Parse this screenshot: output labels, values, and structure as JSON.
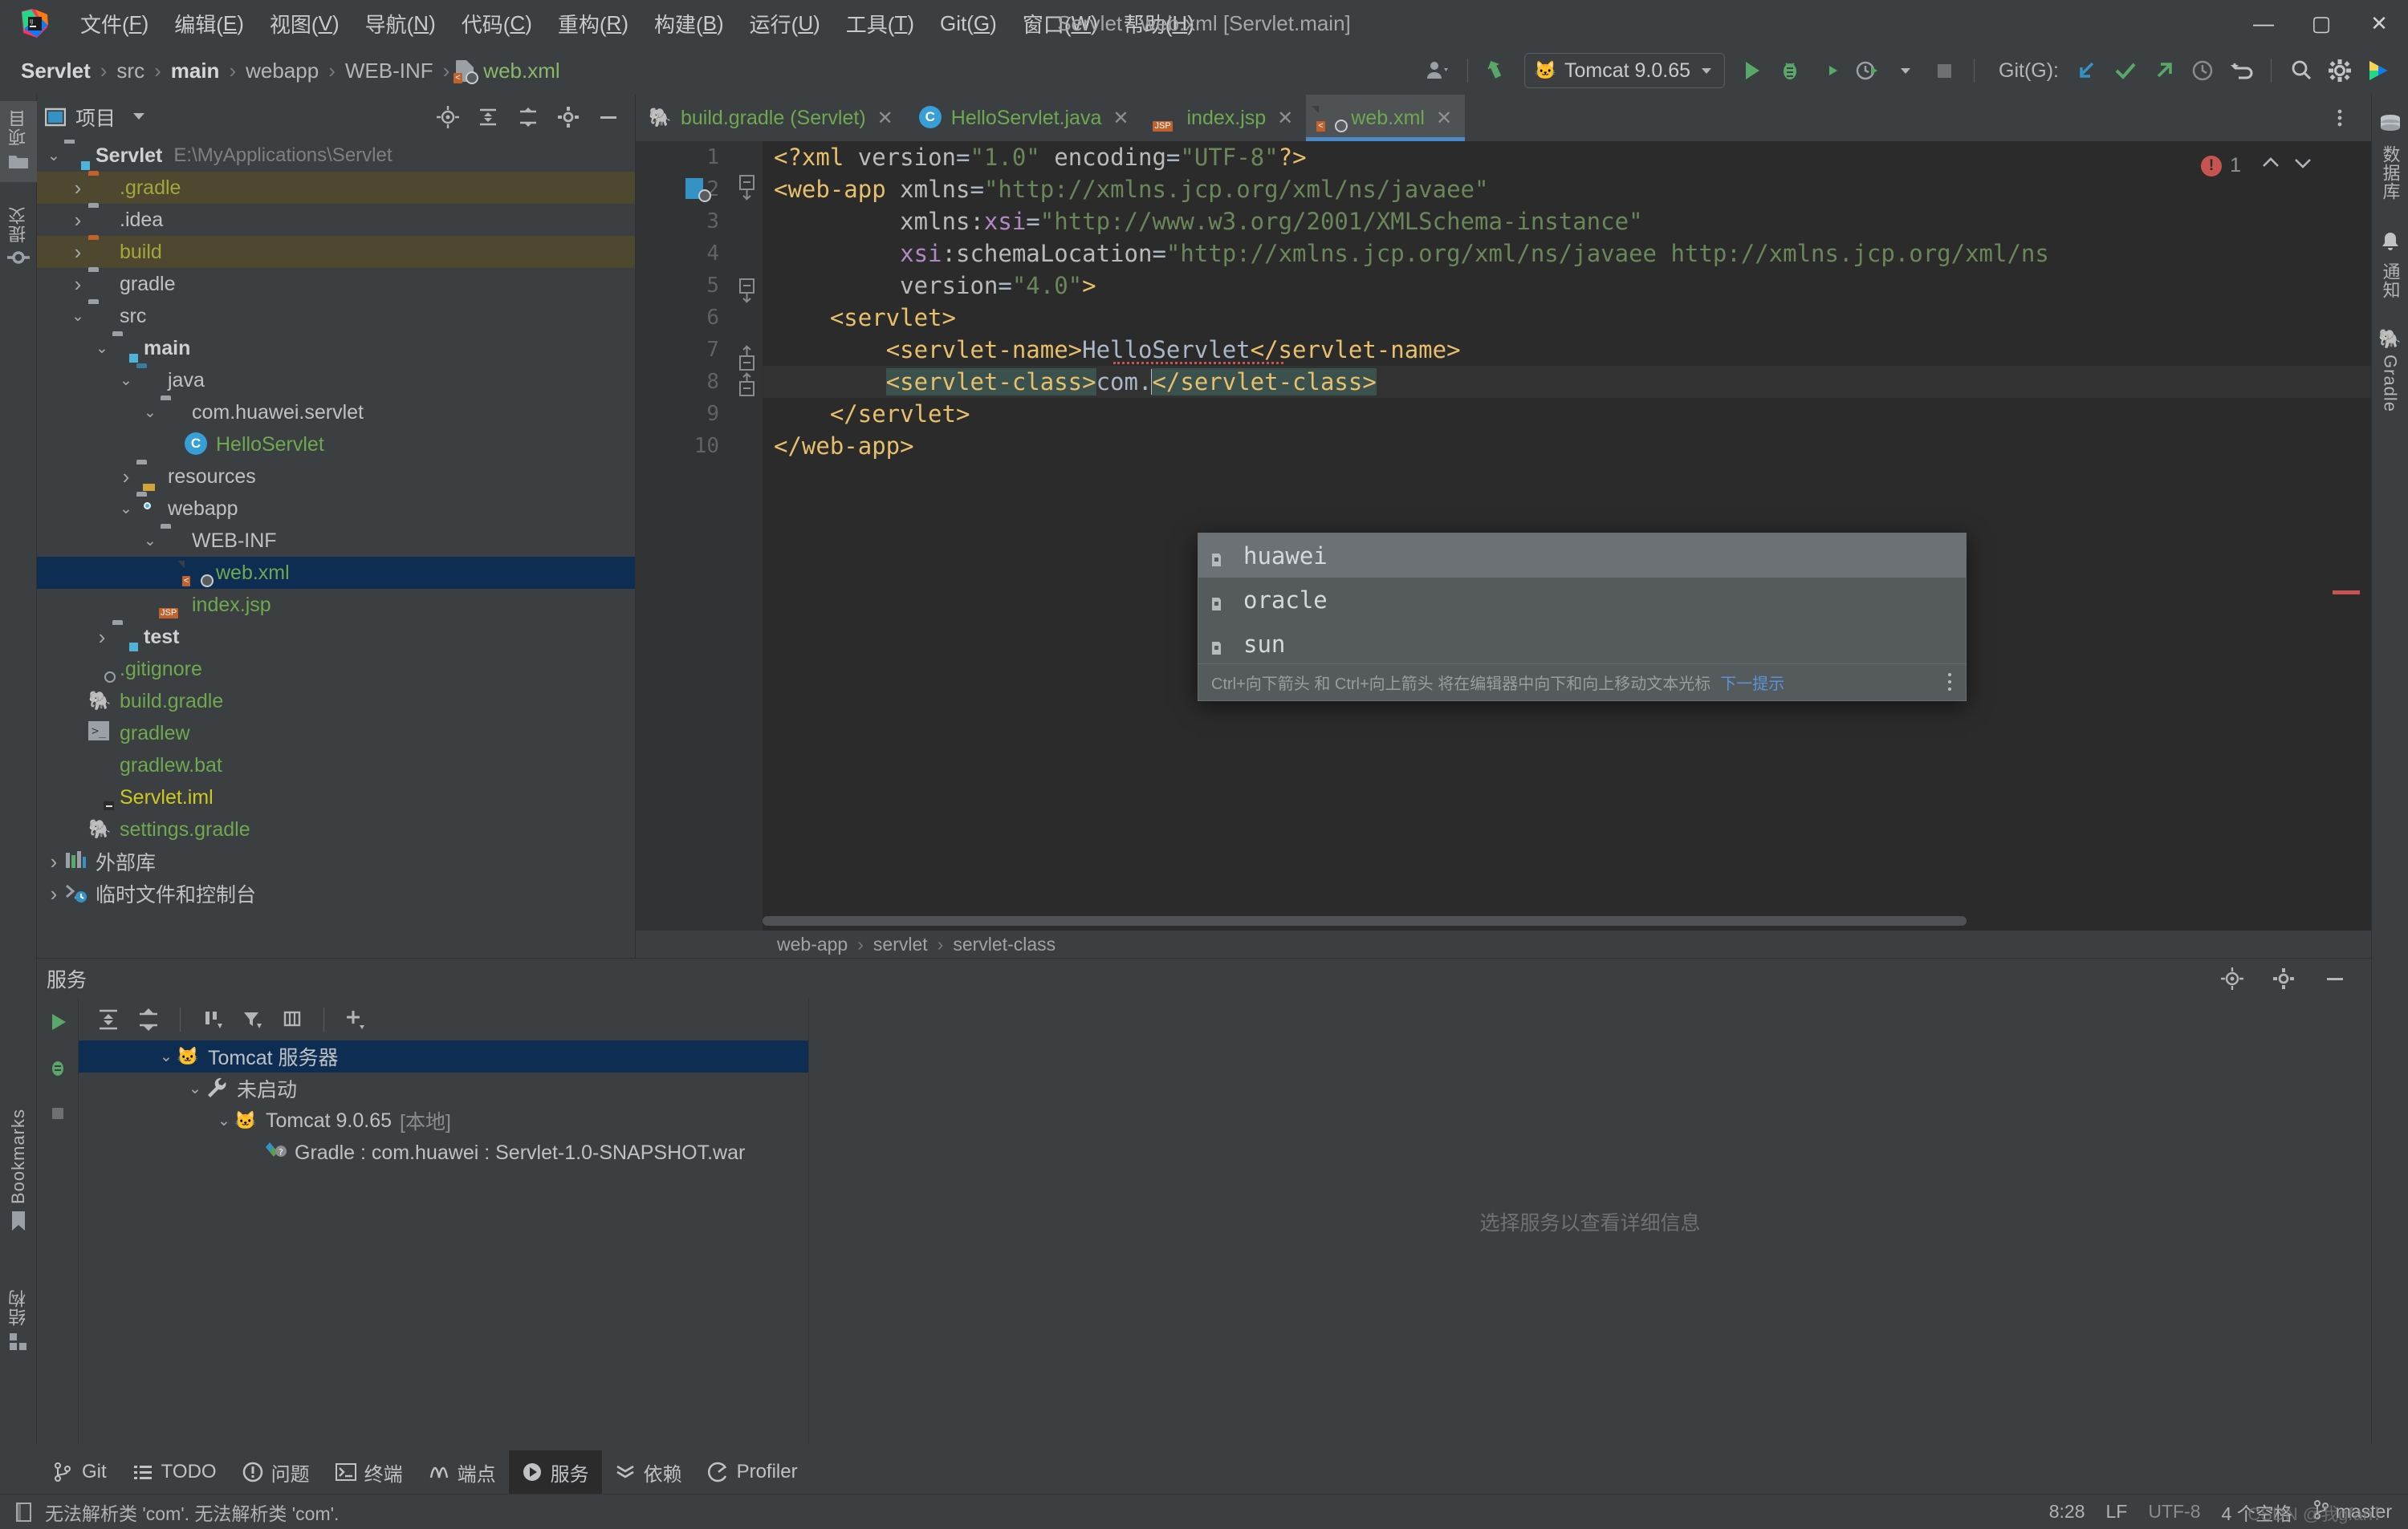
{
  "window": {
    "title": "Servlet - web.xml [Servlet.main]",
    "minimize": "—",
    "maximize": "▢",
    "close": "✕"
  },
  "menubar": {
    "items": [
      {
        "label": "文件(F)",
        "mnemonic": "F"
      },
      {
        "label": "编辑(E)",
        "mnemonic": "E"
      },
      {
        "label": "视图(V)",
        "mnemonic": "V"
      },
      {
        "label": "导航(N)",
        "mnemonic": "N"
      },
      {
        "label": "代码(C)",
        "mnemonic": "C"
      },
      {
        "label": "重构(R)",
        "mnemonic": "R"
      },
      {
        "label": "构建(B)",
        "mnemonic": "B"
      },
      {
        "label": "运行(U)",
        "mnemonic": "U"
      },
      {
        "label": "工具(T)",
        "mnemonic": "T"
      },
      {
        "label": "Git(G)",
        "mnemonic": "G"
      },
      {
        "label": "窗口(W)",
        "mnemonic": "W"
      },
      {
        "label": "帮助(H)",
        "mnemonic": "H"
      }
    ]
  },
  "navbar": {
    "breadcrumbs": [
      {
        "label": "Servlet",
        "style": "bold"
      },
      {
        "label": "src",
        "style": "normal"
      },
      {
        "label": "main",
        "style": "bold"
      },
      {
        "label": "webapp",
        "style": "normal"
      },
      {
        "label": "WEB-INF",
        "style": "normal"
      },
      {
        "label": "web.xml",
        "style": "green",
        "icon": "xml-file-icon"
      }
    ],
    "separator": "›",
    "run_config": "Tomcat 9.0.65",
    "git_label": "Git(G):",
    "icons": [
      "account-icon",
      "updates-icon",
      "run-icon",
      "debug-icon",
      "run-coverage-icon",
      "profiler-icon",
      "stop-icon",
      "git-update-icon",
      "git-commit-icon",
      "git-push-icon",
      "history-icon",
      "undo-icon",
      "search-icon",
      "settings-icon",
      "ide-feature-icon"
    ]
  },
  "left_rail": {
    "items": [
      {
        "label": "项目",
        "icon": "project-icon",
        "active": true
      },
      {
        "label": "提交",
        "icon": "commit-icon",
        "active": false
      }
    ],
    "bottom_items": [
      {
        "label": "Bookmarks",
        "icon": "bookmark-icon"
      },
      {
        "label": "结构",
        "icon": "structure-icon"
      }
    ]
  },
  "right_rail": {
    "items": [
      {
        "label": "数据库",
        "icon": "database-icon"
      },
      {
        "label": "通知",
        "icon": "bell-icon"
      },
      {
        "label": "Gradle",
        "icon": "gradle-elephant-icon"
      }
    ]
  },
  "project_panel": {
    "title": "项目",
    "header_icons": [
      "locate-icon",
      "expand-all-icon",
      "collapse-all-icon",
      "settings-icon",
      "hide-icon"
    ],
    "tree": [
      {
        "label": "Servlet",
        "path": "E:\\MyApplications\\Servlet",
        "depth": 0,
        "arrow": "down",
        "icon": "module-folder-icon",
        "style": "bold",
        "state": "normal"
      },
      {
        "label": ".gradle",
        "depth": 1,
        "arrow": "right",
        "icon": "folder-excluded-icon",
        "style": "olive",
        "state": "excluded"
      },
      {
        "label": ".idea",
        "depth": 1,
        "arrow": "right",
        "icon": "folder-icon",
        "style": "normal",
        "state": "normal"
      },
      {
        "label": "build",
        "depth": 1,
        "arrow": "right",
        "icon": "folder-excluded-icon",
        "style": "olive",
        "state": "excluded"
      },
      {
        "label": "gradle",
        "depth": 1,
        "arrow": "right",
        "icon": "folder-icon",
        "style": "normal",
        "state": "normal"
      },
      {
        "label": "src",
        "depth": 1,
        "arrow": "down",
        "icon": "folder-icon",
        "style": "normal",
        "state": "normal"
      },
      {
        "label": "main",
        "depth": 2,
        "arrow": "down",
        "icon": "module-folder-icon",
        "style": "bold",
        "state": "normal"
      },
      {
        "label": "java",
        "depth": 3,
        "arrow": "down",
        "icon": "source-folder-icon",
        "style": "normal",
        "state": "normal"
      },
      {
        "label": "com.huawei.servlet",
        "depth": 4,
        "arrow": "down",
        "icon": "package-icon",
        "style": "normal",
        "state": "normal"
      },
      {
        "label": "HelloServlet",
        "depth": 5,
        "arrow": "none",
        "icon": "java-class-icon",
        "style": "green",
        "state": "normal"
      },
      {
        "label": "resources",
        "depth": 3,
        "arrow": "right",
        "icon": "resources-folder-icon",
        "style": "normal",
        "state": "normal"
      },
      {
        "label": "webapp",
        "depth": 3,
        "arrow": "down",
        "icon": "web-folder-icon",
        "style": "normal",
        "state": "normal"
      },
      {
        "label": "WEB-INF",
        "depth": 4,
        "arrow": "down",
        "icon": "folder-icon",
        "style": "normal",
        "state": "normal"
      },
      {
        "label": "web.xml",
        "depth": 5,
        "arrow": "none",
        "icon": "xml-file-icon",
        "style": "green",
        "state": "selected"
      },
      {
        "label": "index.jsp",
        "depth": 4,
        "arrow": "none",
        "icon": "jsp-file-icon",
        "style": "green",
        "state": "normal"
      },
      {
        "label": "test",
        "depth": 2,
        "arrow": "right",
        "icon": "module-folder-icon",
        "style": "bold",
        "state": "normal"
      },
      {
        "label": ".gitignore",
        "depth": 1,
        "arrow": "none",
        "icon": "gitignore-file-icon",
        "style": "green",
        "state": "normal"
      },
      {
        "label": "build.gradle",
        "depth": 1,
        "arrow": "none",
        "icon": "gradle-file-icon",
        "style": "green",
        "state": "normal"
      },
      {
        "label": "gradlew",
        "depth": 1,
        "arrow": "none",
        "icon": "shell-file-icon",
        "style": "green",
        "state": "normal"
      },
      {
        "label": "gradlew.bat",
        "depth": 1,
        "arrow": "none",
        "icon": "bat-file-icon",
        "style": "green",
        "state": "normal"
      },
      {
        "label": "Servlet.iml",
        "depth": 1,
        "arrow": "none",
        "icon": "iml-file-icon",
        "style": "yellow",
        "state": "normal"
      },
      {
        "label": "settings.gradle",
        "depth": 1,
        "arrow": "none",
        "icon": "gradle-file-icon",
        "style": "green",
        "state": "normal"
      },
      {
        "label": "外部库",
        "depth": 0,
        "arrow": "right",
        "icon": "libraries-icon",
        "style": "normal",
        "state": "normal"
      },
      {
        "label": "临时文件和控制台",
        "depth": 0,
        "arrow": "right",
        "icon": "scratches-icon",
        "style": "normal",
        "state": "normal"
      }
    ]
  },
  "editor": {
    "tabs": [
      {
        "label": "build.gradle (Servlet)",
        "icon": "gradle-file-icon",
        "active": false,
        "close": "✕"
      },
      {
        "label": "HelloServlet.java",
        "icon": "java-class-icon",
        "active": false,
        "close": "✕"
      },
      {
        "label": "index.jsp",
        "icon": "jsp-file-icon",
        "active": false,
        "close": "✕"
      },
      {
        "label": "web.xml",
        "icon": "xml-file-icon",
        "active": true,
        "close": "✕"
      }
    ],
    "error_count": "1",
    "error_icon": "error-circle-icon",
    "nav_up": "⌃",
    "nav_down": "⌄",
    "line_numbers": [
      "1",
      "2",
      "3",
      "4",
      "5",
      "6",
      "7",
      "8",
      "9",
      "10"
    ],
    "lines": [
      {
        "n": 1,
        "segments": [
          {
            "t": "<?xml ",
            "c": "punct"
          },
          {
            "t": "version",
            "c": "attr"
          },
          {
            "t": "=",
            "c": "txtval"
          },
          {
            "t": "\"1.0\"",
            "c": "str"
          },
          {
            "t": " ",
            "c": "txtval"
          },
          {
            "t": "encoding",
            "c": "attr"
          },
          {
            "t": "=",
            "c": "txtval"
          },
          {
            "t": "\"UTF-8\"",
            "c": "str"
          },
          {
            "t": "?>",
            "c": "punct"
          }
        ]
      },
      {
        "n": 2,
        "segments": [
          {
            "t": "<web-app",
            "c": "tagname"
          },
          {
            "t": " ",
            "c": "txtval"
          },
          {
            "t": "xmlns",
            "c": "attr"
          },
          {
            "t": "=",
            "c": "txtval"
          },
          {
            "t": "\"http://xmlns.jcp.org/xml/ns/javaee\"",
            "c": "str"
          }
        ]
      },
      {
        "n": 3,
        "segments": [
          {
            "t": "         ",
            "c": "txtval"
          },
          {
            "t": "xmlns:",
            "c": "attr"
          },
          {
            "t": "xsi",
            "c": "attrns"
          },
          {
            "t": "=",
            "c": "txtval"
          },
          {
            "t": "\"http://www.w3.org/2001/XMLSchema-instance\"",
            "c": "str"
          }
        ]
      },
      {
        "n": 4,
        "segments": [
          {
            "t": "         ",
            "c": "txtval"
          },
          {
            "t": "xsi",
            "c": "attrns"
          },
          {
            "t": ":schemaLocation",
            "c": "attr"
          },
          {
            "t": "=",
            "c": "txtval"
          },
          {
            "t": "\"http://xmlns.jcp.org/xml/ns/javaee http://xmlns.jcp.org/xml/ns",
            "c": "str"
          }
        ]
      },
      {
        "n": 5,
        "segments": [
          {
            "t": "         ",
            "c": "txtval"
          },
          {
            "t": "version",
            "c": "attr"
          },
          {
            "t": "=",
            "c": "txtval"
          },
          {
            "t": "\"4.0\"",
            "c": "str"
          },
          {
            "t": ">",
            "c": "punct"
          }
        ]
      },
      {
        "n": 6,
        "segments": [
          {
            "t": "    ",
            "c": "txtval"
          },
          {
            "t": "<servlet>",
            "c": "tagname"
          }
        ]
      },
      {
        "n": 7,
        "segments": [
          {
            "t": "        ",
            "c": "txtval"
          },
          {
            "t": "<servlet-name>",
            "c": "tagname"
          },
          {
            "t": "HelloServlet",
            "c": "txtval"
          },
          {
            "t": "</servlet-name>",
            "c": "tagname"
          }
        ]
      },
      {
        "n": 8,
        "segments": [
          {
            "t": "        ",
            "c": "txtval"
          },
          {
            "t": "<servlet-class>",
            "c": "tagname hl-tag"
          },
          {
            "t": "com.",
            "c": "txtval"
          },
          {
            "t": "</servlet-class>",
            "c": "tagname hl-tag"
          }
        ]
      },
      {
        "n": 9,
        "segments": [
          {
            "t": "    ",
            "c": "txtval"
          },
          {
            "t": "</servlet>",
            "c": "tagname"
          }
        ]
      },
      {
        "n": 10,
        "segments": [
          {
            "t": "</web-app>",
            "c": "tagname"
          }
        ]
      }
    ],
    "bottom_breadcrumb": [
      "web-app",
      "servlet",
      "servlet-class"
    ],
    "bottom_breadcrumb_sep": "›"
  },
  "autocomplete": {
    "items": [
      {
        "label": "huawei",
        "icon": "package-icon",
        "selected": true
      },
      {
        "label": "oracle",
        "icon": "package-icon",
        "selected": false
      },
      {
        "label": "sun",
        "icon": "package-icon",
        "selected": false
      }
    ],
    "hint": "Ctrl+向下箭头 和 Ctrl+向上箭头 将在编辑器中向下和向上移动文本光标",
    "hint_link": "下一提示",
    "more_icon": "more-vertical-icon"
  },
  "services": {
    "title": "服务",
    "header_icons": [
      "locate-icon",
      "settings-icon",
      "hide-icon"
    ],
    "rail_icons": [
      "run-icon",
      "debug-icon",
      "stop-icon"
    ],
    "toolbar_icons": [
      "expand-all-icon",
      "collapse-all-icon",
      "sort-icon",
      "filter-icon",
      "group-icon",
      "add-icon"
    ],
    "tree": [
      {
        "label": "Tomcat 服务器",
        "depth": 0,
        "arrow": "down",
        "icon": "tomcat-icon",
        "selected": true,
        "suffix": ""
      },
      {
        "label": "未启动",
        "depth": 1,
        "arrow": "down",
        "icon": "wrench-icon",
        "selected": false,
        "suffix": ""
      },
      {
        "label": "Tomcat 9.0.65",
        "depth": 2,
        "arrow": "down",
        "icon": "tomcat-icon",
        "selected": false,
        "suffix": "[本地]"
      },
      {
        "label": "Gradle : com.huawei : Servlet-1.0-SNAPSHOT.war",
        "depth": 3,
        "arrow": "none",
        "icon": "artifact-icon",
        "selected": false,
        "suffix": ""
      }
    ],
    "empty_detail": "选择服务以查看详细信息"
  },
  "bottom_bar": {
    "buttons": [
      {
        "label": "Git",
        "icon": "git-icon",
        "active": false
      },
      {
        "label": "TODO",
        "icon": "todo-icon",
        "active": false
      },
      {
        "label": "问题",
        "icon": "problems-icon",
        "active": false
      },
      {
        "label": "终端",
        "icon": "terminal-icon",
        "active": false
      },
      {
        "label": "端点",
        "icon": "endpoints-icon",
        "active": false
      },
      {
        "label": "服务",
        "icon": "services-icon",
        "active": true
      },
      {
        "label": "依赖",
        "icon": "dependencies-icon",
        "active": false
      },
      {
        "label": "Profiler",
        "icon": "profiler-icon",
        "active": false
      }
    ]
  },
  "status_bar": {
    "message": "无法解析类 'com'. 无法解析类 'com'.",
    "message_icon": "info-icon",
    "caret_position": "8:28",
    "line_separator": "LF",
    "encoding": "UTF-8",
    "indent": "4 个空格",
    "branch": "master",
    "branch_icon": "git-branch-icon",
    "watermark": "CSDN @我gfan！"
  },
  "colors": {
    "accent_blue": "#4a88c7",
    "selection_blue": "#0d2d52",
    "green": "#6ea84f",
    "error_red": "#c75450",
    "excluded_bg": "#4f4830",
    "editor_bg": "#2b2b2b",
    "panel_bg": "#3c3f41"
  }
}
